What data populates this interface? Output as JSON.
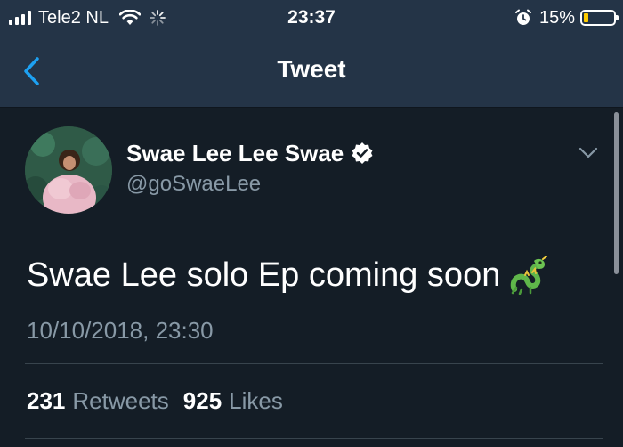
{
  "status_bar": {
    "carrier": "Tele2 NL",
    "time": "23:37",
    "battery_percent": "15%",
    "battery_level": 0.15,
    "icons": [
      "signal-icon",
      "wifi-icon",
      "loading-icon",
      "alarm-icon",
      "battery-icon"
    ]
  },
  "nav": {
    "title": "Tweet",
    "back_icon": "chevron-left-icon"
  },
  "tweet": {
    "display_name": "Swae Lee Lee Swae",
    "verified": true,
    "handle": "@goSwaeLee",
    "text": "Swae Lee solo Ep coming soon",
    "emoji": "dragon-icon",
    "timestamp": "10/10/2018, 23:30",
    "retweets_count": "231",
    "retweets_label": "Retweets",
    "likes_count": "925",
    "likes_label": "Likes"
  },
  "colors": {
    "background": "#141d26",
    "bar": "#243447",
    "accent": "#1da1f2",
    "muted": "#8899a6"
  }
}
